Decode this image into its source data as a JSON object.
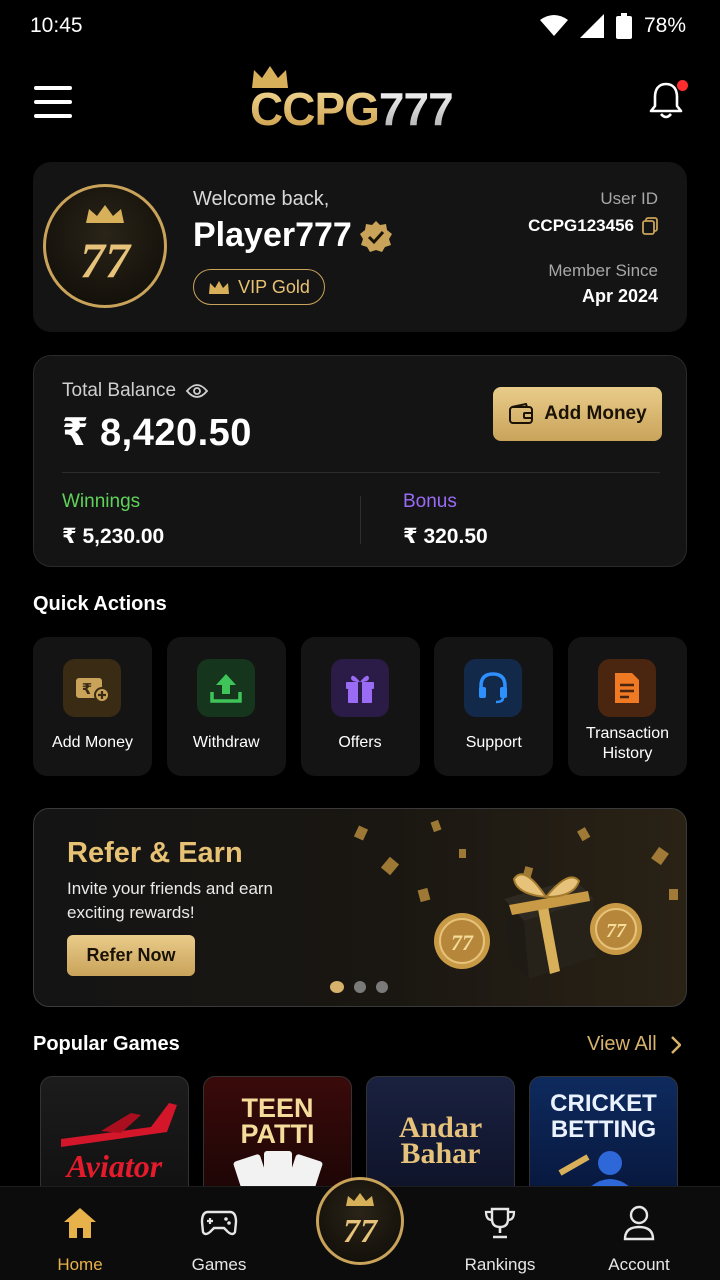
{
  "status_bar": {
    "time": "10:45",
    "battery": "78%"
  },
  "header": {
    "logo_gold": "CCPG",
    "logo_silver": "777"
  },
  "profile": {
    "welcome": "Welcome back,",
    "name": "Player777",
    "vip": "VIP Gold",
    "user_id_label": "User ID",
    "user_id": "CCPG123456",
    "member_since_label": "Member Since",
    "member_since": "Apr 2024",
    "avatar_text": "77"
  },
  "balance": {
    "label": "Total Balance",
    "amount": "₹ 8,420.50",
    "add_money": "Add Money",
    "winnings_label": "Winnings",
    "winnings": "₹ 5,230.00",
    "bonus_label": "Bonus",
    "bonus": "₹ 320.50"
  },
  "quick_actions": {
    "title": "Quick Actions",
    "items": [
      {
        "label": "Add Money",
        "icon": "wallet-plus-icon",
        "color": "#c9a35a"
      },
      {
        "label": "Withdraw",
        "icon": "upload-icon",
        "color": "#3fc45a"
      },
      {
        "label": "Offers",
        "icon": "gift-icon",
        "color": "#9a6bf5"
      },
      {
        "label": "Support",
        "icon": "headset-icon",
        "color": "#2e8fff"
      },
      {
        "label": "Transaction History",
        "icon": "document-icon",
        "color": "#f07a24"
      }
    ]
  },
  "refer": {
    "title": "Refer & Earn",
    "subtitle": "Invite your friends and earn exciting rewards!",
    "button": "Refer Now",
    "coin_text": "77"
  },
  "games": {
    "title": "Popular Games",
    "view_all": "View All",
    "items": [
      "Aviator",
      "TEEN PATTI",
      "Andar Bahar",
      "CRICKET BETTING"
    ]
  },
  "nav": {
    "home": "Home",
    "games": "Games",
    "center": "77",
    "rankings": "Rankings",
    "account": "Account"
  }
}
